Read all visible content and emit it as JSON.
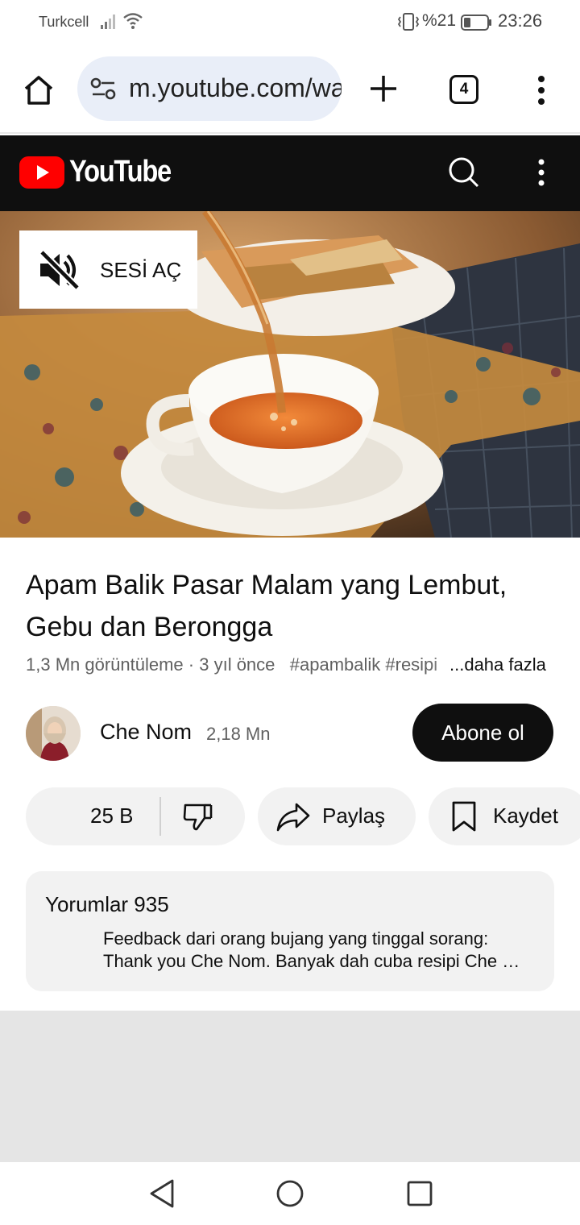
{
  "status_bar": {
    "carrier": "Turkcell",
    "battery": "%21",
    "time": "23:26",
    "icons": [
      "signal-icon",
      "wifi-icon",
      "vibrate-icon",
      "battery-icon"
    ]
  },
  "browser": {
    "url": "m.youtube.com/watch",
    "tab_count": "4",
    "icons": [
      "home-icon",
      "site-settings-icon",
      "plus-icon",
      "more-vert-icon"
    ]
  },
  "youtube_header": {
    "logo_text": "YouTube",
    "icons": [
      "youtube-logo-icon",
      "search-icon",
      "more-vert-icon"
    ]
  },
  "video": {
    "unmute_label": "SESİ AÇ"
  },
  "details": {
    "title": "Apam Balik Pasar Malam yang Lembut, Gebu dan Berongga",
    "views": "1,3 Mn görüntüleme",
    "age": "3 yıl önce",
    "tags": "#apambalik #resipi",
    "more": "...daha fazla"
  },
  "channel": {
    "name": "Che Nom",
    "subscribers": "2,18 Mn",
    "subscribe_label": "Abone ol"
  },
  "actions": {
    "likes": "25 B",
    "share": "Paylaş",
    "save": "Kaydet"
  },
  "comments": {
    "header": "Yorumlar 935",
    "line1": "Feedback dari orang bujang yang tinggal sorang:",
    "line2": "Thank you Che Nom. Banyak dah cuba resipi Che Nom yang sedap"
  },
  "colors": {
    "youtube_red": "#ff0000",
    "header_bg": "#0f0f0f",
    "pill_bg": "#f2f2f2",
    "url_bg": "#e9eef8"
  }
}
